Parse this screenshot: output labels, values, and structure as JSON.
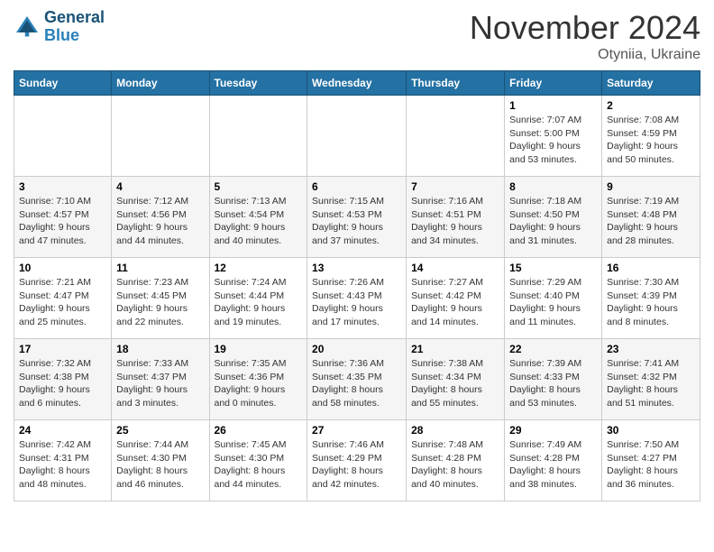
{
  "logo": {
    "line1": "General",
    "line2": "Blue"
  },
  "title": "November 2024",
  "location": "Otyniia, Ukraine",
  "days_header": [
    "Sunday",
    "Monday",
    "Tuesday",
    "Wednesday",
    "Thursday",
    "Friday",
    "Saturday"
  ],
  "weeks": [
    [
      {
        "num": "",
        "info": ""
      },
      {
        "num": "",
        "info": ""
      },
      {
        "num": "",
        "info": ""
      },
      {
        "num": "",
        "info": ""
      },
      {
        "num": "",
        "info": ""
      },
      {
        "num": "1",
        "info": "Sunrise: 7:07 AM\nSunset: 5:00 PM\nDaylight: 9 hours and 53 minutes."
      },
      {
        "num": "2",
        "info": "Sunrise: 7:08 AM\nSunset: 4:59 PM\nDaylight: 9 hours and 50 minutes."
      }
    ],
    [
      {
        "num": "3",
        "info": "Sunrise: 7:10 AM\nSunset: 4:57 PM\nDaylight: 9 hours and 47 minutes."
      },
      {
        "num": "4",
        "info": "Sunrise: 7:12 AM\nSunset: 4:56 PM\nDaylight: 9 hours and 44 minutes."
      },
      {
        "num": "5",
        "info": "Sunrise: 7:13 AM\nSunset: 4:54 PM\nDaylight: 9 hours and 40 minutes."
      },
      {
        "num": "6",
        "info": "Sunrise: 7:15 AM\nSunset: 4:53 PM\nDaylight: 9 hours and 37 minutes."
      },
      {
        "num": "7",
        "info": "Sunrise: 7:16 AM\nSunset: 4:51 PM\nDaylight: 9 hours and 34 minutes."
      },
      {
        "num": "8",
        "info": "Sunrise: 7:18 AM\nSunset: 4:50 PM\nDaylight: 9 hours and 31 minutes."
      },
      {
        "num": "9",
        "info": "Sunrise: 7:19 AM\nSunset: 4:48 PM\nDaylight: 9 hours and 28 minutes."
      }
    ],
    [
      {
        "num": "10",
        "info": "Sunrise: 7:21 AM\nSunset: 4:47 PM\nDaylight: 9 hours and 25 minutes."
      },
      {
        "num": "11",
        "info": "Sunrise: 7:23 AM\nSunset: 4:45 PM\nDaylight: 9 hours and 22 minutes."
      },
      {
        "num": "12",
        "info": "Sunrise: 7:24 AM\nSunset: 4:44 PM\nDaylight: 9 hours and 19 minutes."
      },
      {
        "num": "13",
        "info": "Sunrise: 7:26 AM\nSunset: 4:43 PM\nDaylight: 9 hours and 17 minutes."
      },
      {
        "num": "14",
        "info": "Sunrise: 7:27 AM\nSunset: 4:42 PM\nDaylight: 9 hours and 14 minutes."
      },
      {
        "num": "15",
        "info": "Sunrise: 7:29 AM\nSunset: 4:40 PM\nDaylight: 9 hours and 11 minutes."
      },
      {
        "num": "16",
        "info": "Sunrise: 7:30 AM\nSunset: 4:39 PM\nDaylight: 9 hours and 8 minutes."
      }
    ],
    [
      {
        "num": "17",
        "info": "Sunrise: 7:32 AM\nSunset: 4:38 PM\nDaylight: 9 hours and 6 minutes."
      },
      {
        "num": "18",
        "info": "Sunrise: 7:33 AM\nSunset: 4:37 PM\nDaylight: 9 hours and 3 minutes."
      },
      {
        "num": "19",
        "info": "Sunrise: 7:35 AM\nSunset: 4:36 PM\nDaylight: 9 hours and 0 minutes."
      },
      {
        "num": "20",
        "info": "Sunrise: 7:36 AM\nSunset: 4:35 PM\nDaylight: 8 hours and 58 minutes."
      },
      {
        "num": "21",
        "info": "Sunrise: 7:38 AM\nSunset: 4:34 PM\nDaylight: 8 hours and 55 minutes."
      },
      {
        "num": "22",
        "info": "Sunrise: 7:39 AM\nSunset: 4:33 PM\nDaylight: 8 hours and 53 minutes."
      },
      {
        "num": "23",
        "info": "Sunrise: 7:41 AM\nSunset: 4:32 PM\nDaylight: 8 hours and 51 minutes."
      }
    ],
    [
      {
        "num": "24",
        "info": "Sunrise: 7:42 AM\nSunset: 4:31 PM\nDaylight: 8 hours and 48 minutes."
      },
      {
        "num": "25",
        "info": "Sunrise: 7:44 AM\nSunset: 4:30 PM\nDaylight: 8 hours and 46 minutes."
      },
      {
        "num": "26",
        "info": "Sunrise: 7:45 AM\nSunset: 4:30 PM\nDaylight: 8 hours and 44 minutes."
      },
      {
        "num": "27",
        "info": "Sunrise: 7:46 AM\nSunset: 4:29 PM\nDaylight: 8 hours and 42 minutes."
      },
      {
        "num": "28",
        "info": "Sunrise: 7:48 AM\nSunset: 4:28 PM\nDaylight: 8 hours and 40 minutes."
      },
      {
        "num": "29",
        "info": "Sunrise: 7:49 AM\nSunset: 4:28 PM\nDaylight: 8 hours and 38 minutes."
      },
      {
        "num": "30",
        "info": "Sunrise: 7:50 AM\nSunset: 4:27 PM\nDaylight: 8 hours and 36 minutes."
      }
    ]
  ]
}
